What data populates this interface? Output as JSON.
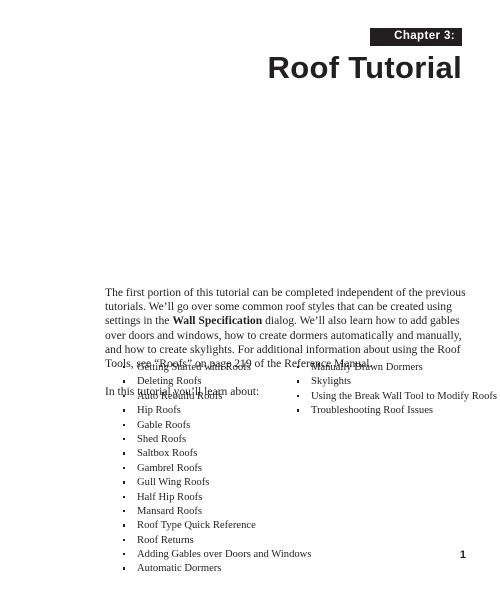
{
  "header": {
    "chapter_label": "Chapter 3:",
    "title": "Roof Tutorial",
    "banner_color": "#231f20"
  },
  "body": {
    "intro_part_1": "The first portion of this tutorial can be completed independent of the previous tutorials. We’ll go over some common roof styles that can be created using settings in the ",
    "intro_bold": "Wall Specification",
    "intro_part_2": " dialog. We’ll also learn how to add gables over doors and windows, how to create dormers automatically and manually, and how to create skylights. For additional information about using the Roof Tools, see “Roofs” on page 219 of the Reference Manual.",
    "learn_lead": "In this tutorial you’ll learn about:"
  },
  "topics": {
    "left_column": [
      "Getting Started with Roofs",
      "Deleting Roofs",
      "Auto Rebuild Roofs",
      "Hip Roofs",
      "Gable Roofs",
      "Shed Roofs",
      "Saltbox Roofs",
      "Gambrel Roofs",
      "Gull Wing Roofs",
      "Half Hip Roofs",
      "Mansard Roofs",
      "Roof Type Quick Reference",
      "Roof Returns",
      "Adding Gables over Doors and Windows",
      "Automatic Dormers"
    ],
    "right_column": [
      "Manually Drawn Dormers",
      "Skylights",
      "Using the Break Wall Tool to Modify Roofs",
      "Troubleshooting Roof Issues"
    ]
  },
  "footer": {
    "page_number": "1"
  }
}
